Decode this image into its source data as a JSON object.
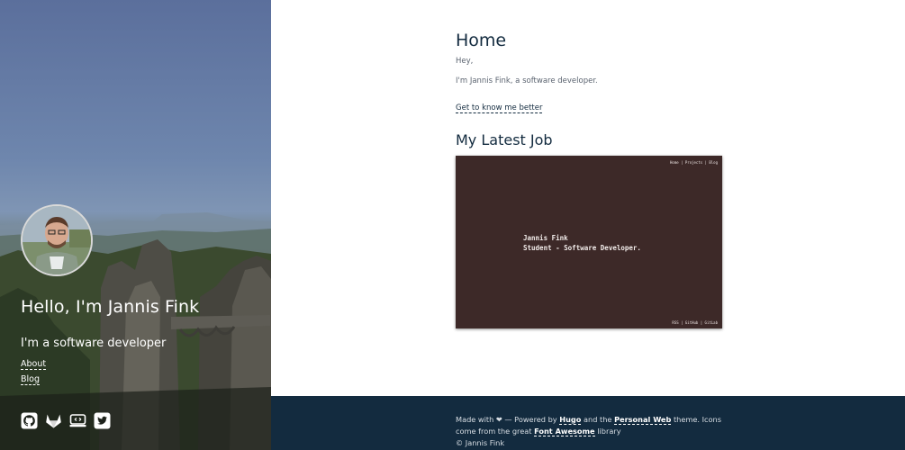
{
  "sidebar": {
    "title": "Hello, I'm Jannis Fink",
    "subtitle": "I'm a software developer",
    "nav": [
      {
        "label": "About"
      },
      {
        "label": "Blog"
      }
    ],
    "social": [
      {
        "icon": "github-icon"
      },
      {
        "icon": "gitlab-icon"
      },
      {
        "icon": "stackexchange-icon"
      },
      {
        "icon": "twitter-icon"
      }
    ]
  },
  "main": {
    "heading": "Home",
    "greeting": "Hey,",
    "intro": "I'm Jannis Fink, a software developer.",
    "more_link": "Get to know me better",
    "job_heading": "My Latest Job",
    "job_preview": {
      "nav": "Home  |  Projects  |  Blog",
      "name": "Jannis Fink",
      "tagline": "Student - Software Developer.",
      "footer": "RSS  |  GitHub  |  GitLab"
    }
  },
  "footer": {
    "made_with": "Made with",
    "heart": "❤",
    "powered_by": "— Powered by",
    "hugo": "Hugo",
    "and_the": "and the",
    "theme_name": "Personal Web",
    "theme_icons": "theme. Icons come from the great",
    "font_awesome": "Font Awesome",
    "library": "library",
    "copyright": "© Jannis Fink"
  },
  "colors": {
    "footer_bg": "#132b3f",
    "heading": "#132b3f",
    "job_bg": "#3d2928"
  }
}
